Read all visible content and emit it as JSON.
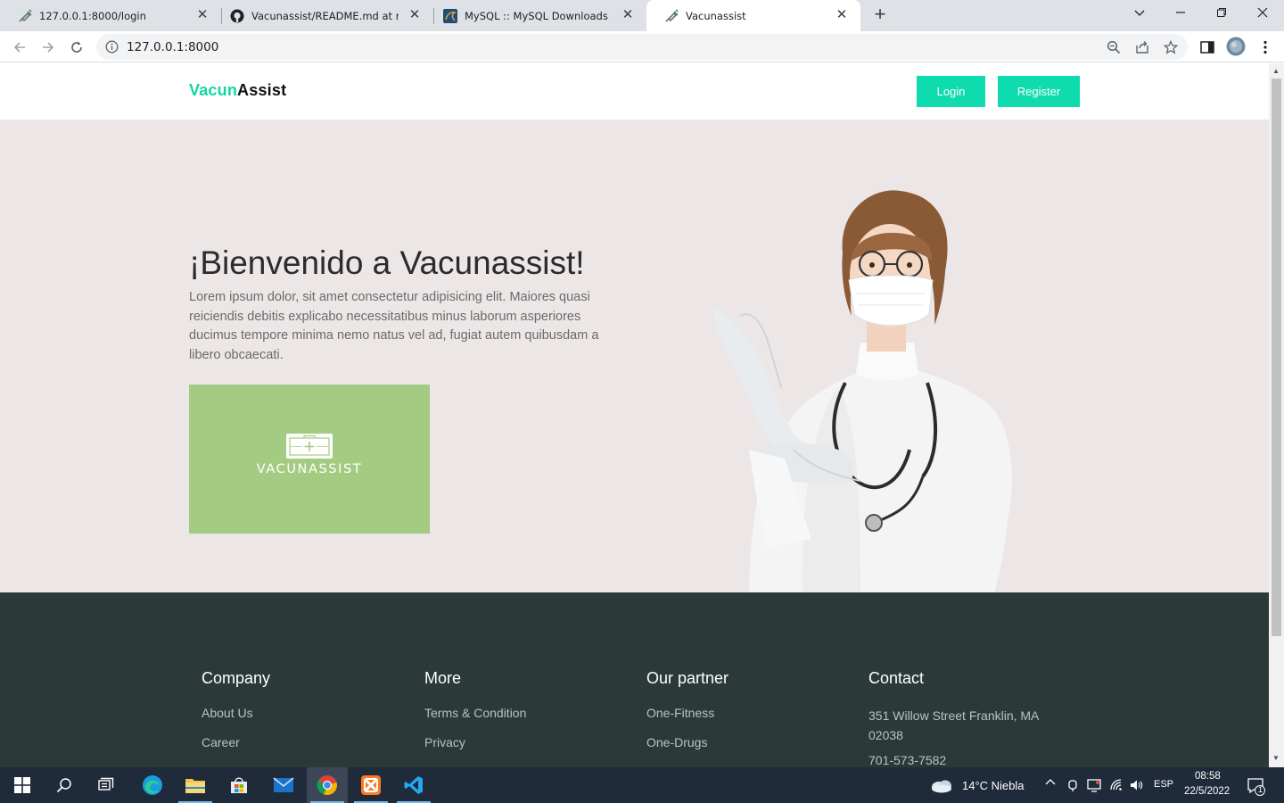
{
  "browser": {
    "tabs": [
      {
        "title": "127.0.0.1:8000/login",
        "icon": "syringe-icon",
        "active": false
      },
      {
        "title": "Vacunassist/README.md at mast",
        "icon": "github-icon",
        "active": false
      },
      {
        "title": "MySQL :: MySQL Downloads",
        "icon": "mysql-icon",
        "active": false
      },
      {
        "title": "Vacunassist",
        "icon": "syringe-icon",
        "active": true
      }
    ],
    "url": "127.0.0.1:8000"
  },
  "site": {
    "brand_part1": "Vacun",
    "brand_part2": "Assist",
    "brand_color": "#13d6a5",
    "header_buttons": {
      "login": "Login",
      "register": "Register"
    },
    "button_color": "#0fdcae",
    "hero": {
      "title": "¡Bienvenido a Vacunassist!",
      "text": "Lorem ipsum dolor, sit amet consectetur adipisicing elit. Maiores quasi reiciendis debitis explicabo necessitatibus minus laborum asperiores ducimus tempore minima nemo natus vel ad, fugiat autem quibusdam a libero obcaecati.",
      "logo_text": "VACUNASSIST",
      "background": "#ede6e6"
    },
    "footer": {
      "background": "#2b3a38",
      "columns": [
        {
          "title": "Company",
          "links": [
            "About Us",
            "Career"
          ]
        },
        {
          "title": "More",
          "links": [
            "Terms & Condition",
            "Privacy"
          ]
        },
        {
          "title": "Our partner",
          "links": [
            "One-Fitness",
            "One-Drugs"
          ]
        },
        {
          "title": "Contact",
          "address": "351 Willow Street Franklin, MA 02038",
          "phone": "701-573-7582"
        }
      ]
    }
  },
  "taskbar": {
    "weather": "14°C  Niebla",
    "language": "ESP",
    "time": "08:58",
    "date": "22/5/2022",
    "notifications": "1"
  }
}
